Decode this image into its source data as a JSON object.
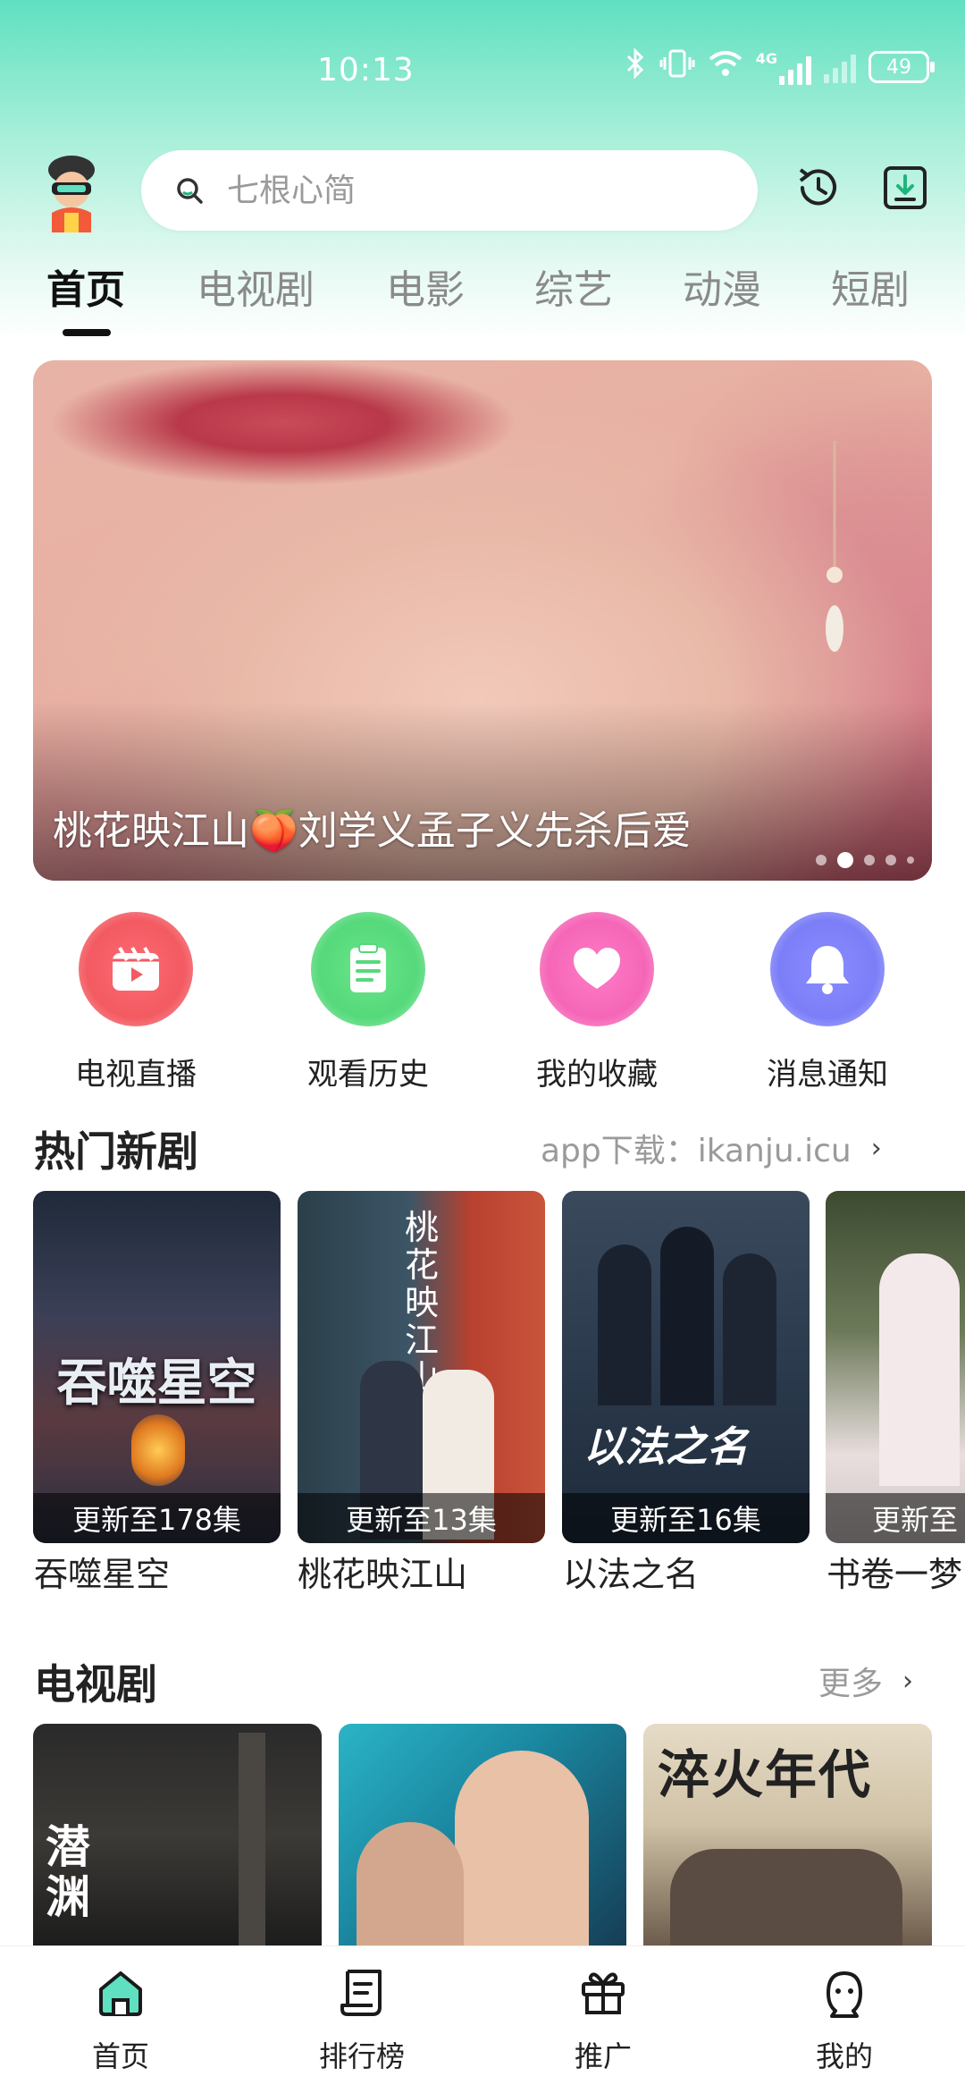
{
  "status_bar": {
    "time": "10:13",
    "network_type": "4G",
    "battery": "49"
  },
  "search": {
    "placeholder": "七根心简"
  },
  "tabs": [
    {
      "label": "首页"
    },
    {
      "label": "电视剧"
    },
    {
      "label": "电影"
    },
    {
      "label": "综艺"
    },
    {
      "label": "动漫"
    },
    {
      "label": "短剧"
    }
  ],
  "banner": {
    "title": "桃花映江山🍑刘学义孟子义先杀后爱",
    "current_index": 2,
    "total": 5
  },
  "quick_entries": [
    {
      "label": "电视直播",
      "icon": "tv-live-icon",
      "color": "#f35a62"
    },
    {
      "label": "观看历史",
      "icon": "history-list-icon",
      "color": "#55d97a"
    },
    {
      "label": "我的收藏",
      "icon": "heart-icon",
      "color": "#f566b7"
    },
    {
      "label": "消息通知",
      "icon": "bell-icon",
      "color": "#7b7ef7"
    }
  ],
  "hot_section": {
    "title": "热门新剧",
    "more": "app下载：ikanju.icu",
    "items": [
      {
        "name": "吞噬星空",
        "badge": "更新至178集",
        "poster_text": "吞噬星空"
      },
      {
        "name": "桃花映江山",
        "badge": "更新至13集",
        "poster_text": "桃花映江山"
      },
      {
        "name": "以法之名",
        "badge": "更新至16集",
        "poster_text": "以法之名"
      },
      {
        "name": "书卷一梦",
        "badge": "更新至",
        "poster_text": ""
      }
    ]
  },
  "tv_section": {
    "title": "电视剧",
    "more": "更多",
    "items": [
      {
        "poster_text": "潜渊"
      },
      {
        "poster_text": ""
      },
      {
        "poster_text": "淬火年代"
      }
    ]
  },
  "bottom_nav": [
    {
      "label": "首页",
      "icon": "home-icon"
    },
    {
      "label": "排行榜",
      "icon": "ranking-icon"
    },
    {
      "label": "推广",
      "icon": "gift-icon"
    },
    {
      "label": "我的",
      "icon": "profile-icon"
    }
  ],
  "colors": {
    "accent": "#5fe0c0",
    "active_nav": "#1fb57d"
  }
}
